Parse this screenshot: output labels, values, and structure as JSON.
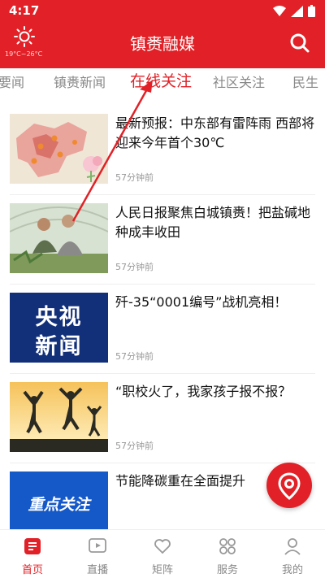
{
  "status_bar": {
    "time": "4:17"
  },
  "header": {
    "weather_temp": "19°C~26°C",
    "title": "镇赉融媒"
  },
  "tabs": [
    {
      "label": "要闻"
    },
    {
      "label": "镇赉新闻"
    },
    {
      "label": "在线关注",
      "active": true
    },
    {
      "label": "社区关注"
    },
    {
      "label": "民生"
    }
  ],
  "news": [
    {
      "title": "最新预报：中东部有雷阵雨 西部将迎来今年首个30℃",
      "time": "57分钟前"
    },
    {
      "title": "人民日报聚焦白城镇赉！把盐碱地种成丰收田",
      "time": "57分钟前"
    },
    {
      "title": "歼-35“0001编号”战机亮相！",
      "time": "57分钟前",
      "thumb_text": [
        "央视",
        "新闻"
      ]
    },
    {
      "title": "“职校火了，我家孩子报不报？",
      "time": "57分钟前"
    },
    {
      "title": "节能降碳重在全面提升",
      "time": "",
      "thumb_text": [
        "重点关注"
      ]
    }
  ],
  "bottom_nav": [
    {
      "label": "首页",
      "icon": "home-icon",
      "active": true
    },
    {
      "label": "直播",
      "icon": "live-icon"
    },
    {
      "label": "矩阵",
      "icon": "heart-icon"
    },
    {
      "label": "服务",
      "icon": "services-icon"
    },
    {
      "label": "我的",
      "icon": "profile-icon"
    }
  ],
  "colors": {
    "brand": "#e12127",
    "muted": "#888888",
    "text": "#111111"
  }
}
